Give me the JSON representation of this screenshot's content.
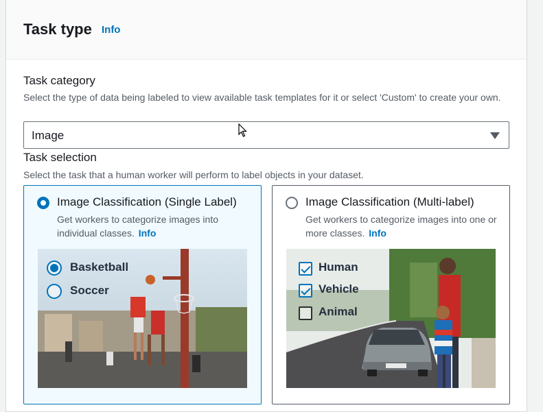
{
  "section": {
    "title": "Task type",
    "info": "Info"
  },
  "task_category": {
    "label": "Task category",
    "description": "Select the type of data being labeled to view available task templates for it or select 'Custom' to create your own.",
    "selected": "Image"
  },
  "task_selection": {
    "label": "Task selection",
    "description": "Select the task that a human worker will perform to label objects in your dataset.",
    "tiles": [
      {
        "title": "Image Classification (Single Label)",
        "description": "Get workers to categorize images into individual classes.",
        "info": "Info",
        "selected": true,
        "example_options": [
          "Basketball",
          "Soccer"
        ]
      },
      {
        "title": "Image Classification (Multi-label)",
        "description": "Get workers to categorize images into one or more classes.",
        "info": "Info",
        "selected": false,
        "example_options": [
          "Human",
          "Vehicle",
          "Animal"
        ]
      }
    ]
  },
  "colors": {
    "accent": "#0073bb",
    "text": "#16191f",
    "secondary_text": "#545b64"
  }
}
